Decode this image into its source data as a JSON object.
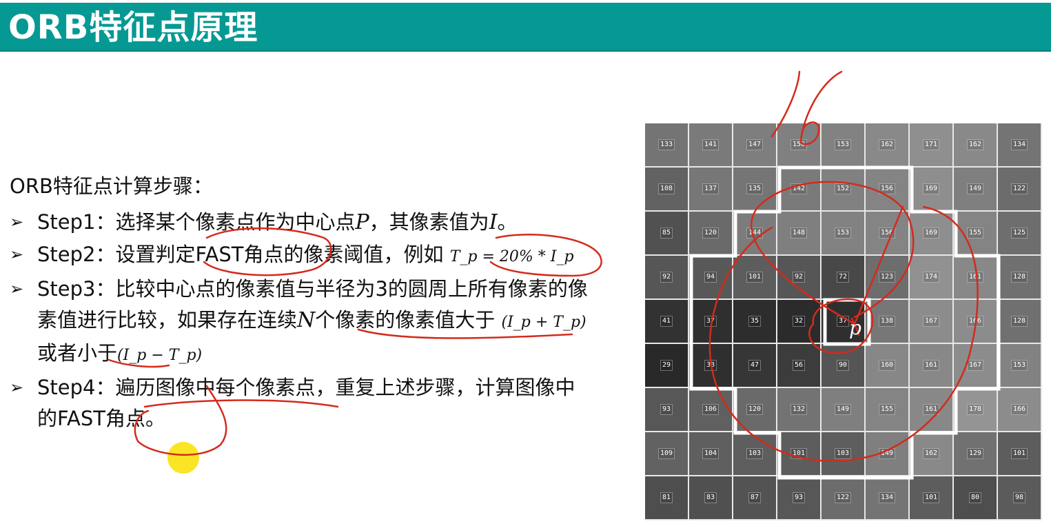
{
  "header": {
    "title": "ORB特征点原理"
  },
  "body": {
    "intro": "ORB特征点计算步骤：",
    "steps": [
      {
        "text_before": "Step1：选择某个像素点作为中心点",
        "var_p": "P",
        "text_mid": "，其像素值为",
        "var_i": "I",
        "text_after": "。"
      },
      {
        "text_before": "Step2：设置判定FAST角点的像素阈值，例如",
        "formula": "T_p = 20% * I_p"
      },
      {
        "text_before": "Step3：比较中心点的像素值与半径为3的圆周上所有像素的像素值进行比较，如果存在连续",
        "var_n": "N",
        "text_mid": "个像素的像素值大于",
        "formula_plus": "(I_p + T_p)",
        "text_or": "或者小于",
        "formula_minus": "(I_p − T_p)"
      },
      {
        "text_before": "Step4：遍历图像中每个像素点，重复上述步骤，计算图像中的FAST角点。"
      }
    ]
  },
  "pixel_grid": {
    "rows": [
      [
        "133",
        "141",
        "147",
        "150",
        "153",
        "162",
        "171",
        "162",
        "134"
      ],
      [
        "108",
        "137",
        "135",
        "142",
        "152",
        "156",
        "169",
        "149",
        "122"
      ],
      [
        "85",
        "120",
        "144",
        "148",
        "153",
        "156",
        "169",
        "155",
        "125"
      ],
      [
        "92",
        "94",
        "101",
        "92",
        "72",
        "123",
        "174",
        "161",
        "128"
      ],
      [
        "41",
        "37",
        "35",
        "32",
        "37",
        "138",
        "167",
        "166",
        "128"
      ],
      [
        "29",
        "38",
        "47",
        "56",
        "90",
        "160",
        "161",
        "167",
        "153"
      ],
      [
        "93",
        "106",
        "120",
        "132",
        "149",
        "155",
        "161",
        "178",
        "166"
      ],
      [
        "109",
        "104",
        "103",
        "101",
        "103",
        "149",
        "162",
        "129",
        "101"
      ],
      [
        "81",
        "83",
        "87",
        "93",
        "122",
        "134",
        "101",
        "80",
        "98"
      ]
    ],
    "center_label": "p"
  },
  "annotations": {
    "handwritten_number": "16"
  },
  "colors": {
    "title_bar": "#069994",
    "annotation_red": "#d42a1c",
    "pointer": "#fae31a"
  }
}
